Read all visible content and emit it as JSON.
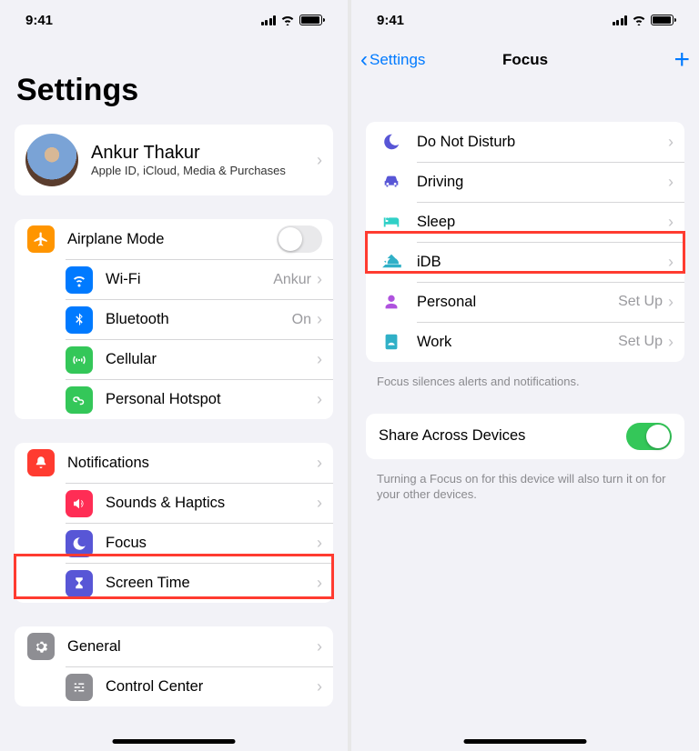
{
  "status": {
    "time": "9:41"
  },
  "left": {
    "title": "Settings",
    "profile": {
      "name": "Ankur Thakur",
      "subtitle": "Apple ID, iCloud, Media & Purchases"
    },
    "group1": {
      "airplane": "Airplane Mode",
      "wifi": "Wi-Fi",
      "wifi_detail": "Ankur",
      "bluetooth": "Bluetooth",
      "bluetooth_detail": "On",
      "cellular": "Cellular",
      "hotspot": "Personal Hotspot"
    },
    "group2": {
      "notifications": "Notifications",
      "sounds": "Sounds & Haptics",
      "focus": "Focus",
      "screentime": "Screen Time"
    },
    "group3": {
      "general": "General",
      "controlcenter": "Control Center"
    }
  },
  "right": {
    "back": "Settings",
    "title": "Focus",
    "modes": {
      "dnd": "Do Not Disturb",
      "driving": "Driving",
      "sleep": "Sleep",
      "idb": "iDB",
      "personal": "Personal",
      "personal_detail": "Set Up",
      "work": "Work",
      "work_detail": "Set Up"
    },
    "footer1": "Focus silences alerts and notifications.",
    "share": "Share Across Devices",
    "footer2": "Turning a Focus on for this device will also turn it on for your other devices."
  },
  "colors": {
    "orange": "#ff9500",
    "blue": "#007aff",
    "green": "#34c759",
    "red": "#ff3b30",
    "indigo": "#5856d6",
    "gray": "#8e8e93",
    "teal": "#30b0c7"
  }
}
